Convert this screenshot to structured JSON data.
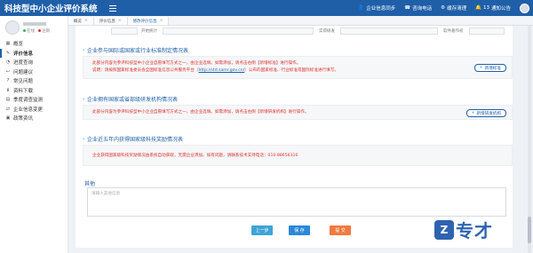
{
  "app_title": "科技型中小企业评价系统",
  "top_actions": [
    {
      "icon": "user-icon",
      "label": "企业信息同步"
    },
    {
      "icon": "phone-icon",
      "label": "咨询电话"
    },
    {
      "icon": "gear-icon",
      "label": "缓存清理"
    },
    {
      "icon": "bell-icon",
      "label": "通知公告",
      "badge": "13"
    }
  ],
  "user": {
    "online": "在线",
    "logout": "注销"
  },
  "nav": [
    {
      "icon": "grid-icon",
      "label": "概览"
    },
    {
      "icon": "pencil-icon",
      "label": "评价信息",
      "active": true
    },
    {
      "icon": "progress-icon",
      "label": "进度查询"
    },
    {
      "icon": "reply-icon",
      "label": "问题建议"
    },
    {
      "icon": "question-icon",
      "label": "常见问题"
    },
    {
      "icon": "download-icon",
      "label": "资料下载"
    },
    {
      "icon": "quarter-icon",
      "label": "季度调查监测"
    },
    {
      "icon": "change-icon",
      "label": "企业信息变更"
    },
    {
      "icon": "news-icon",
      "label": "政策资讯"
    }
  ],
  "tabs": [
    {
      "label": "概览"
    },
    {
      "label": "评价信息"
    },
    {
      "label": "修改评价信息",
      "active": true
    }
  ],
  "top_fields": [
    {
      "label": "开始统计"
    },
    {
      "label": "实得研发"
    },
    {
      "label": "软件著作权"
    }
  ],
  "sections": {
    "standards": {
      "title": "企业参与国际或国家或行业标准制定情况表",
      "line1": "此部分内容为参评科技型中小企业自愿填写方式之一，由企业选填。如需添加，请点击右侧【新增标准】进行操作。",
      "line2_prefix": "说明：请按照国家标准委员会全国标准信息公共服务平台（",
      "line2_link": "http://std.samr.gov.cn/",
      "line2_suffix": "）公布的国家标准、行业标准或国际标准进行填写。",
      "button": "新增标准"
    },
    "rnd": {
      "title": "企业拥有国家或省部级研发机构情况表",
      "line1": "此部分内容为参评科技型中小企业自愿填写方式之一，由企业选填。如需添加，请点击右侧【新增研发机构】进行操作。",
      "button": "新增研发机构"
    },
    "awards": {
      "title": "企业近五年内获得国家级科技奖励情况表",
      "line1": "企业获得国家级科技奖励情况由系统自动获取，无需企业添加。如有问题，请联系技术支持电话：010-88656316"
    }
  },
  "other": {
    "label": "其他",
    "placeholder": "请输入其他信息"
  },
  "buttons": {
    "prev": "上一步",
    "save": "保 存",
    "submit": "提 交"
  },
  "watermark": {
    "mark": "Z",
    "text": "专才"
  }
}
